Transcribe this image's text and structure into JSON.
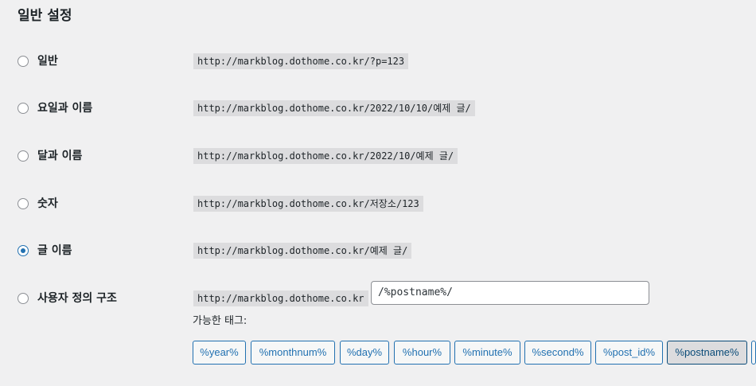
{
  "section_title": "일반 설정",
  "permalink_options": [
    {
      "label": "일반",
      "example": "http://markblog.dothome.co.kr/?p=123",
      "checked": false
    },
    {
      "label": "요일과 이름",
      "example": "http://markblog.dothome.co.kr/2022/10/10/예제 글/",
      "checked": false
    },
    {
      "label": "달과 이름",
      "example": "http://markblog.dothome.co.kr/2022/10/예제 글/",
      "checked": false
    },
    {
      "label": "숫자",
      "example": "http://markblog.dothome.co.kr/저장소/123",
      "checked": false
    },
    {
      "label": "글 이름",
      "example": "http://markblog.dothome.co.kr/예제 글/",
      "checked": true
    },
    {
      "label": "사용자 정의 구조",
      "example": "http://markblog.dothome.co.kr",
      "checked": false
    }
  ],
  "custom_structure_value": "/%postname%/",
  "available_tags_label": "가능한 태그:",
  "tags": [
    {
      "label": "%year%",
      "active": false
    },
    {
      "label": "%monthnum%",
      "active": false
    },
    {
      "label": "%day%",
      "active": false
    },
    {
      "label": "%hour%",
      "active": false
    },
    {
      "label": "%minute%",
      "active": false
    },
    {
      "label": "%second%",
      "active": false
    },
    {
      "label": "%post_id%",
      "active": false
    },
    {
      "label": "%postname%",
      "active": true
    }
  ],
  "colors": {
    "accent": "#2271b1",
    "background": "#f0f0f1",
    "code_background": "#dcdcde"
  }
}
